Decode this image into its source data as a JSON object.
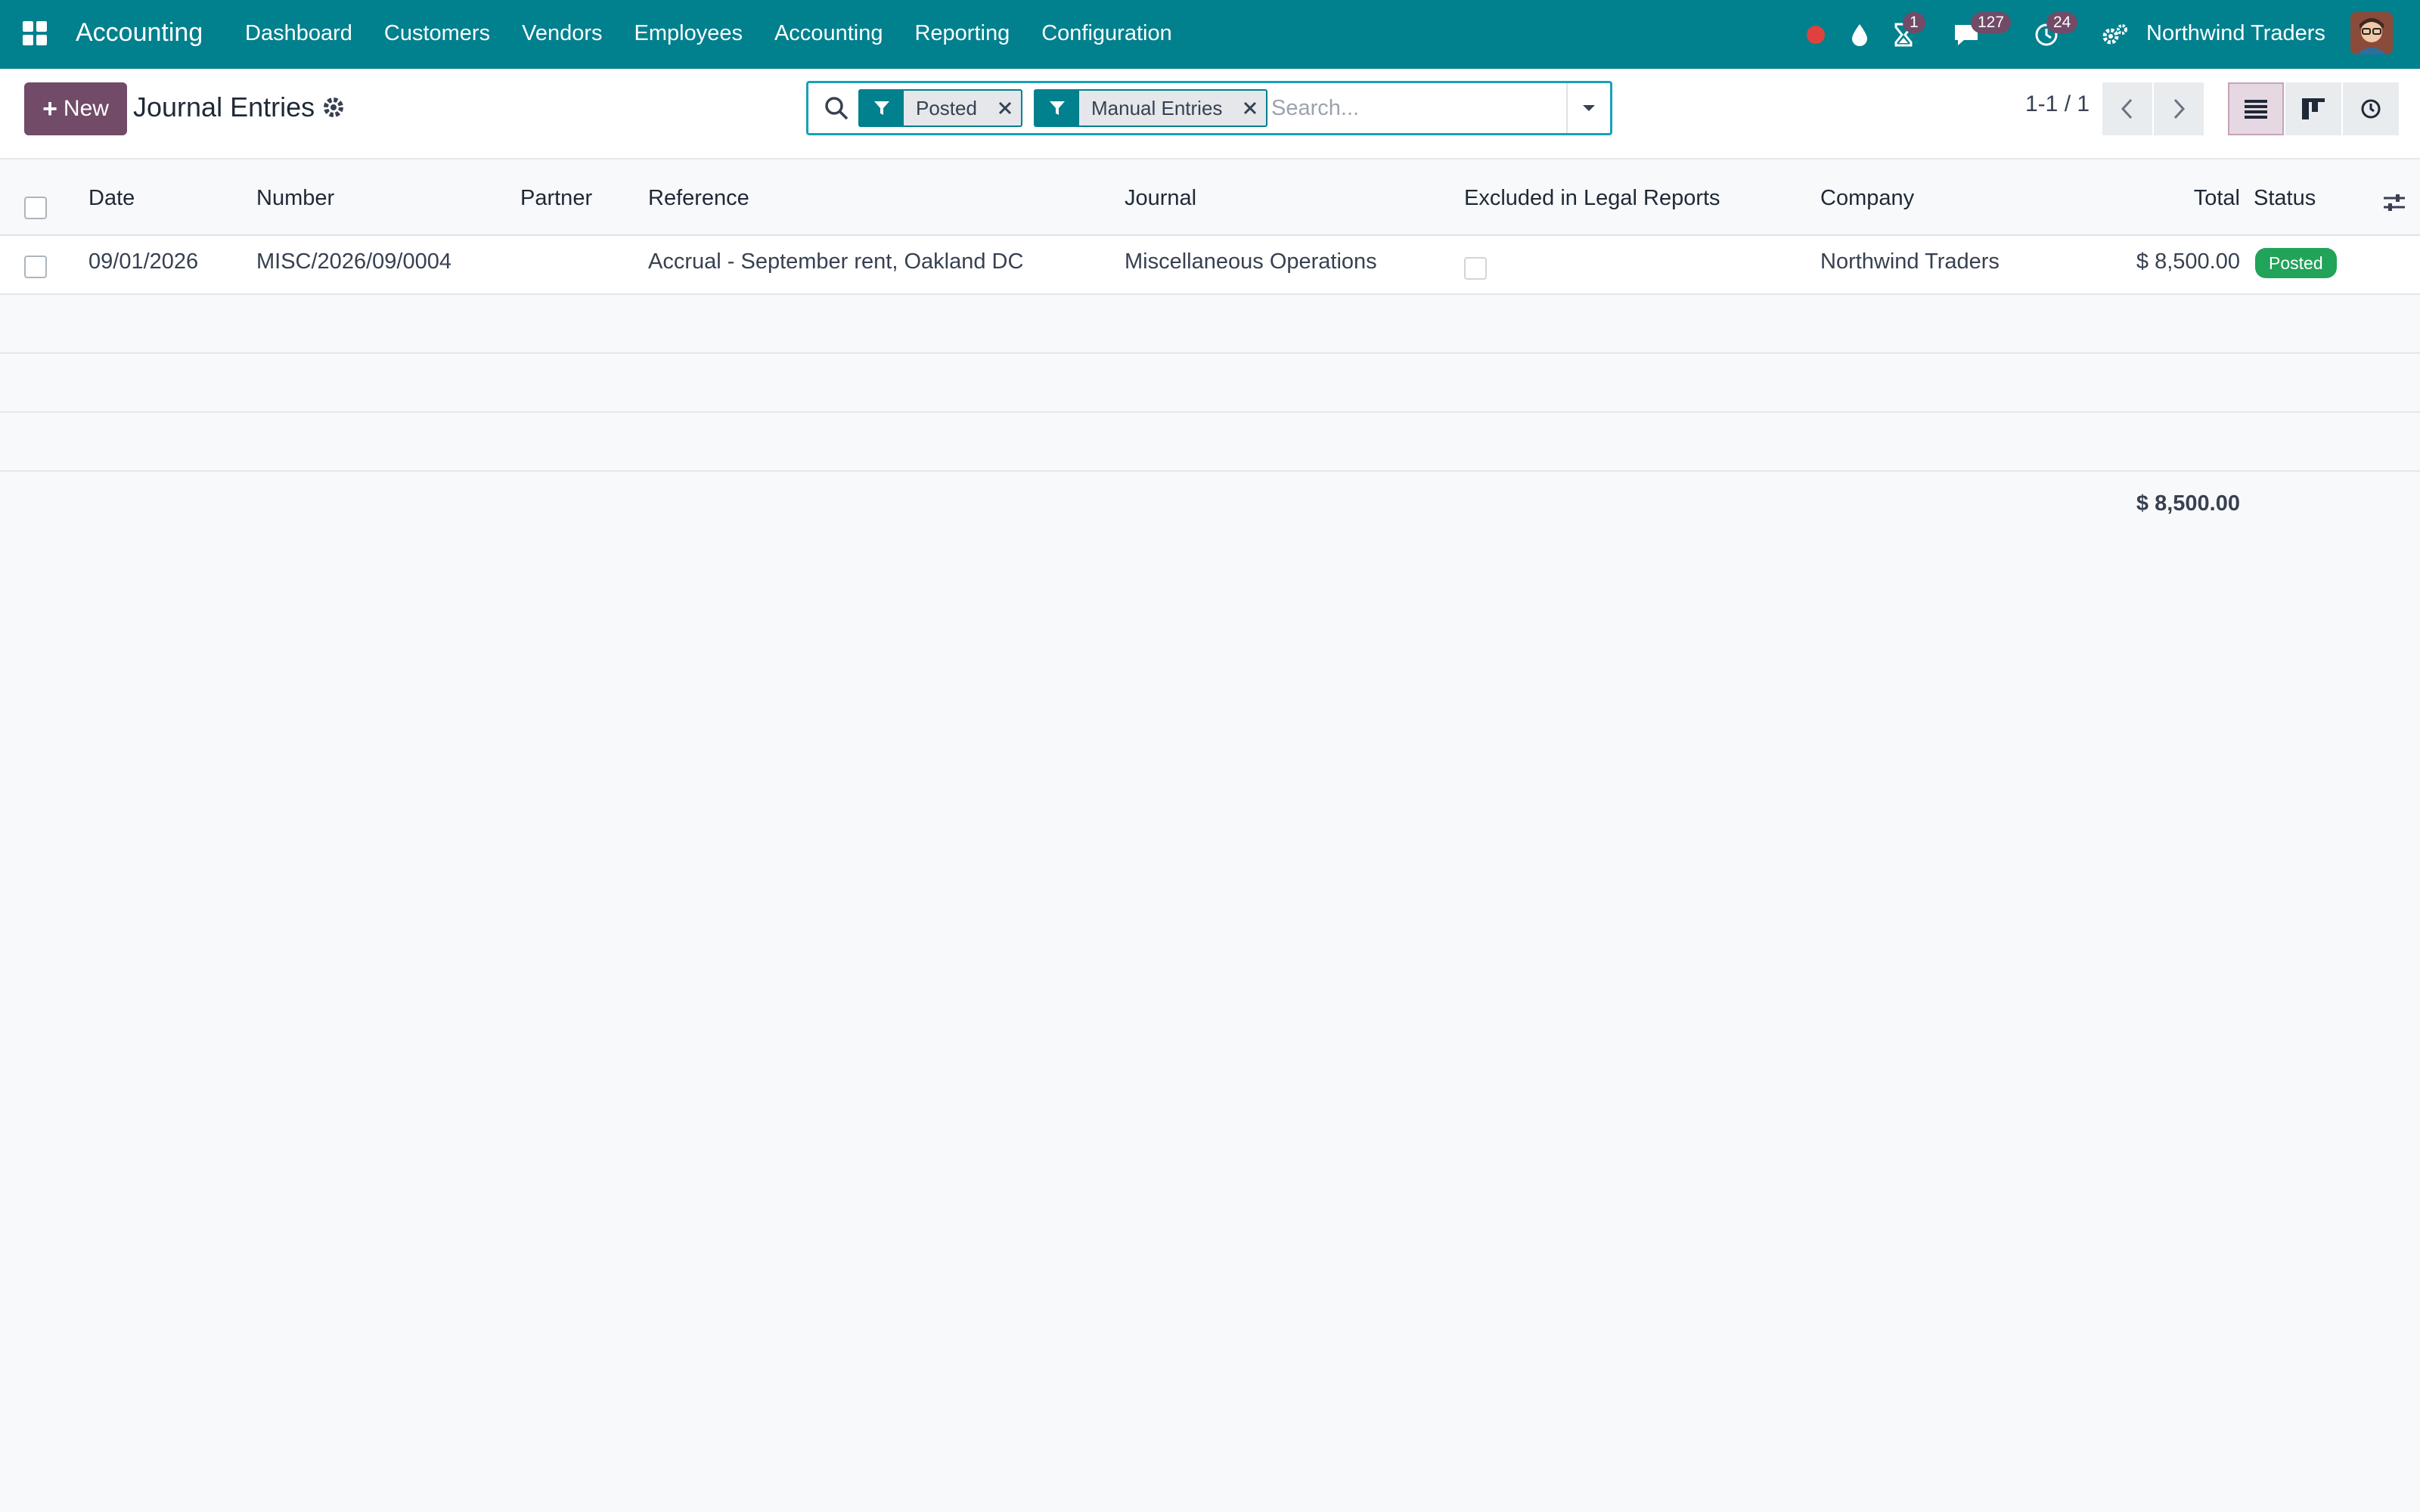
{
  "colors": {
    "navbar": "#01808e",
    "primary": "#714b67",
    "posted_badge": "#21a35a"
  },
  "navbar": {
    "app_name": "Accounting",
    "menu": [
      "Dashboard",
      "Customers",
      "Vendors",
      "Employees",
      "Accounting",
      "Reporting",
      "Configuration"
    ],
    "activity_badge": "1",
    "messages_badge": "127",
    "clock_badge": "24",
    "company": "Northwind Traders",
    "icons": [
      "apps-grid-icon",
      "recording-dot-icon",
      "drop-icon",
      "hourglass-icon",
      "chat-icon",
      "clock-icon",
      "settings-icon"
    ]
  },
  "control_panel": {
    "new_label": "New",
    "title": "Journal Entries",
    "facets": [
      "Posted",
      "Manual Entries"
    ],
    "search_placeholder": "Search...",
    "pager": "1-1 / 1"
  },
  "table": {
    "headers": [
      "Date",
      "Number",
      "Partner",
      "Reference",
      "Journal",
      "Excluded in Legal Reports",
      "Company",
      "Total",
      "Status"
    ],
    "rows": [
      {
        "date": "09/01/2026",
        "number": "MISC/2026/09/0004",
        "partner": "",
        "reference": "Accrual - September rent, Oakland DC",
        "journal": "Miscellaneous Operations",
        "excluded": false,
        "company": "Northwind Traders",
        "total": "$ 8,500.00",
        "status": "Posted"
      }
    ],
    "grand_total": "$ 8,500.00"
  }
}
